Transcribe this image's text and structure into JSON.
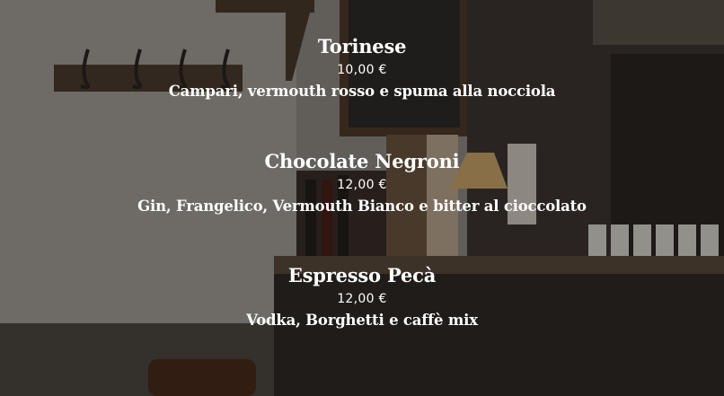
{
  "menu": {
    "items": [
      {
        "name": "Torinese",
        "price": "10,00 €",
        "description": "Campari, vermouth rosso e spuma alla nocciola"
      },
      {
        "name": "Chocolate Negroni",
        "price": "12,00 €",
        "description": "Gin, Frangelico, Vermouth Bianco e bitter al cioccolato"
      },
      {
        "name": "Espresso Pecà",
        "price": "12,00 €",
        "description": "Vodka, Borghetti e caffè mix"
      }
    ]
  }
}
